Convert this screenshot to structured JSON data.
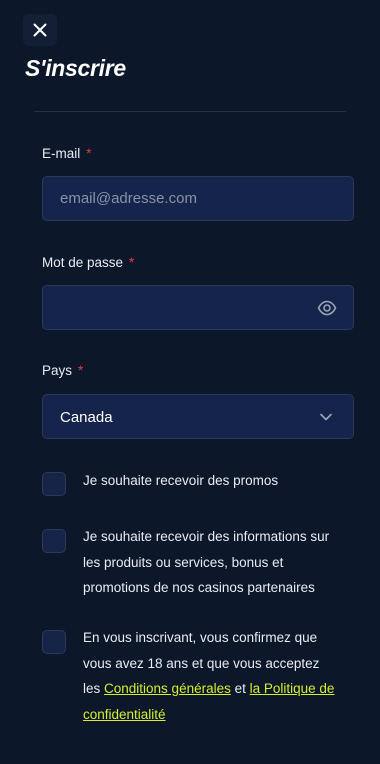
{
  "header": {
    "title": "S'inscrire"
  },
  "form": {
    "email": {
      "label": "E-mail",
      "required_mark": "*",
      "placeholder": "email@adresse.com",
      "value": ""
    },
    "password": {
      "label": "Mot de passe",
      "required_mark": "*",
      "value": ""
    },
    "country": {
      "label": "Pays",
      "required_mark": "*",
      "selected": "Canada"
    }
  },
  "checkboxes": {
    "promos": {
      "label": "Je souhaite recevoir des promos",
      "checked": false
    },
    "partners": {
      "label": "Je souhaite recevoir des informations sur les produits ou services, bonus et promotions de nos casinos partenaires",
      "checked": false
    },
    "terms": {
      "text_before": "En vous inscrivant, vous confirmez que vous avez 18 ans et que vous acceptez les ",
      "terms_link": "Conditions générales",
      "connector": " et ",
      "privacy_link": "la Politique de confidentialité",
      "checked": false
    }
  },
  "icons": {
    "close": "close-icon",
    "eye": "eye-icon",
    "chevron": "chevron-down-icon"
  },
  "colors": {
    "background": "#0c1729",
    "input_background": "#14244a",
    "required": "#e33b4c",
    "link": "#d6ef2e"
  }
}
